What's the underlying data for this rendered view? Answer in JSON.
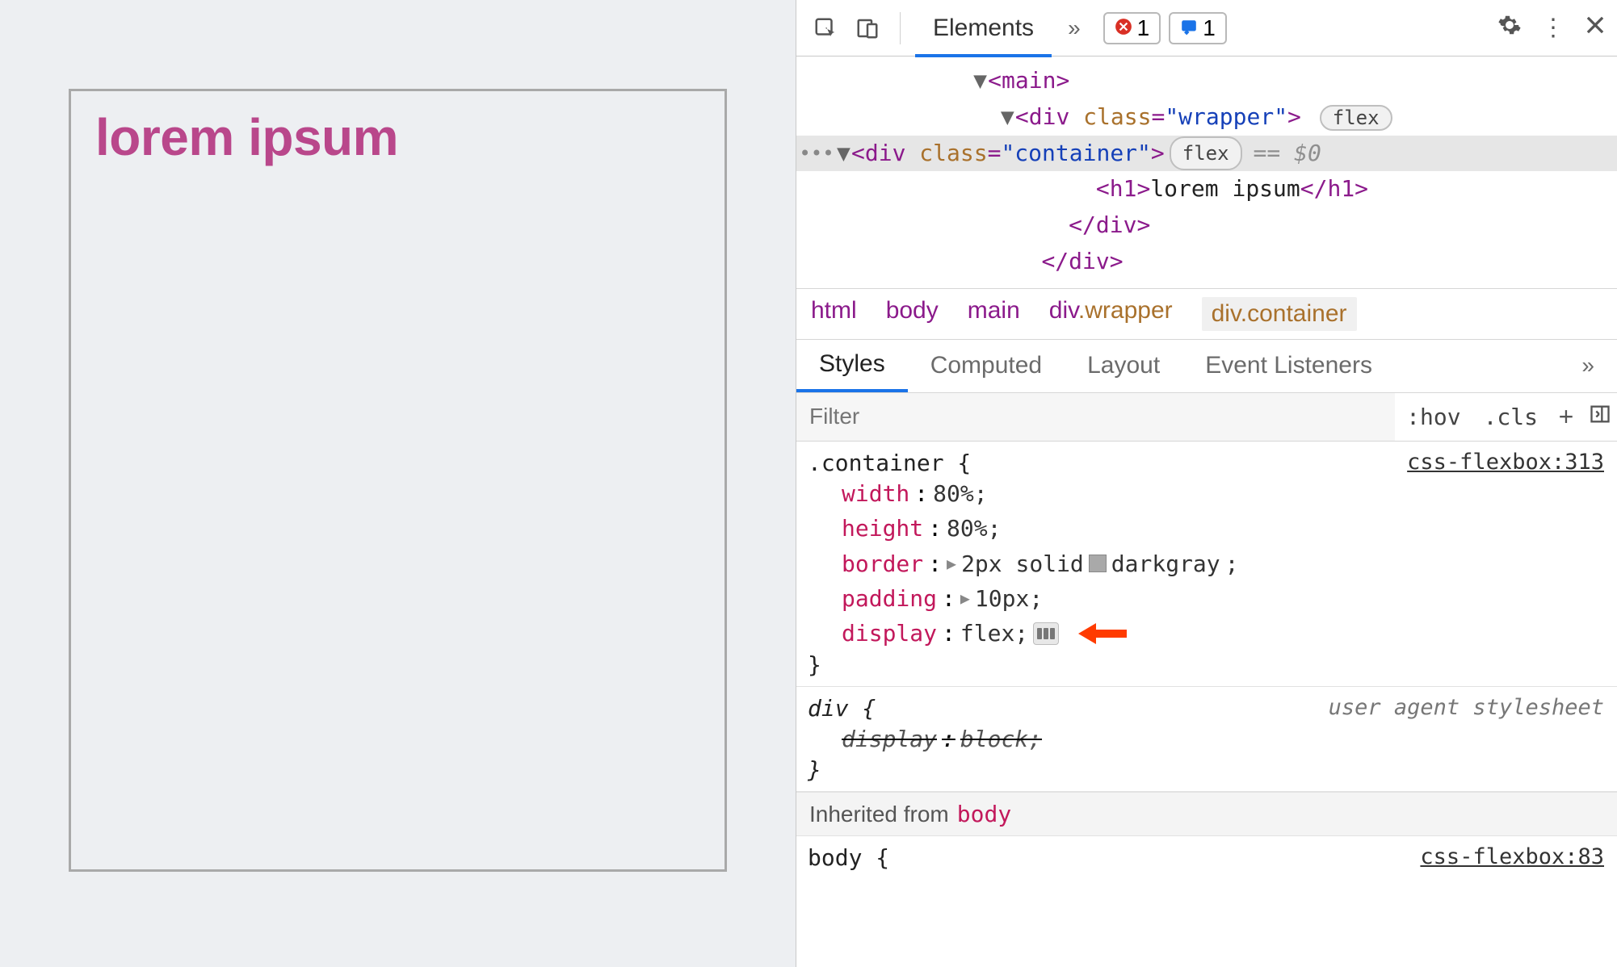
{
  "preview": {
    "heading_text": "lorem ipsum"
  },
  "toolbar": {
    "tab_elements": "Elements",
    "more_glyph": "»",
    "err_count": "1",
    "msg_count": "1"
  },
  "dom": {
    "main_open": "<main>",
    "wrapper_open_pre": "<div ",
    "wrapper_attr_name": "class",
    "wrapper_attr_val": "\"wrapper\"",
    "wrapper_open_post": ">",
    "wrapper_flex_badge": "flex",
    "container_open_pre": "<div ",
    "container_attr_name": "class",
    "container_attr_val": "\"container\"",
    "container_open_post": ">",
    "container_flex_badge": "flex",
    "selected_note": "== $0",
    "h1_open": "<h1>",
    "h1_text": "lorem ipsum",
    "h1_close": "</h1>",
    "div_close1": "</div>",
    "div_close2": "</div>"
  },
  "breadcrumb": {
    "c0": "html",
    "c1": "body",
    "c2": "main",
    "c3_tag": "div",
    "c3_cls": ".wrapper",
    "c4_tag": "div",
    "c4_cls": ".container"
  },
  "subtabs": {
    "styles": "Styles",
    "computed": "Computed",
    "layout": "Layout",
    "events": "Event Listeners",
    "more": "»"
  },
  "filter": {
    "placeholder": "Filter",
    "hov": ":hov",
    "cls": ".cls",
    "plus": "+"
  },
  "rule_container": {
    "selector": ".container {",
    "source": "css-flexbox:313",
    "d_width_p": "width",
    "d_width_v": "80%;",
    "d_height_p": "height",
    "d_height_v": "80%;",
    "d_border_p": "border",
    "d_border_v_pre": "2px solid ",
    "d_border_color": "darkgray",
    "d_border_semi": ";",
    "d_padding_p": "padding",
    "d_padding_v": "10px;",
    "d_display_p": "display",
    "d_display_v": "flex;",
    "close": "}"
  },
  "rule_div": {
    "selector": "div {",
    "source": "user agent stylesheet",
    "d_display_p": "display",
    "d_display_v": "block;",
    "close": "}"
  },
  "inherited": {
    "label": "Inherited from",
    "from": "body"
  },
  "rule_body": {
    "selector": "body {",
    "source": "css-flexbox:83"
  }
}
